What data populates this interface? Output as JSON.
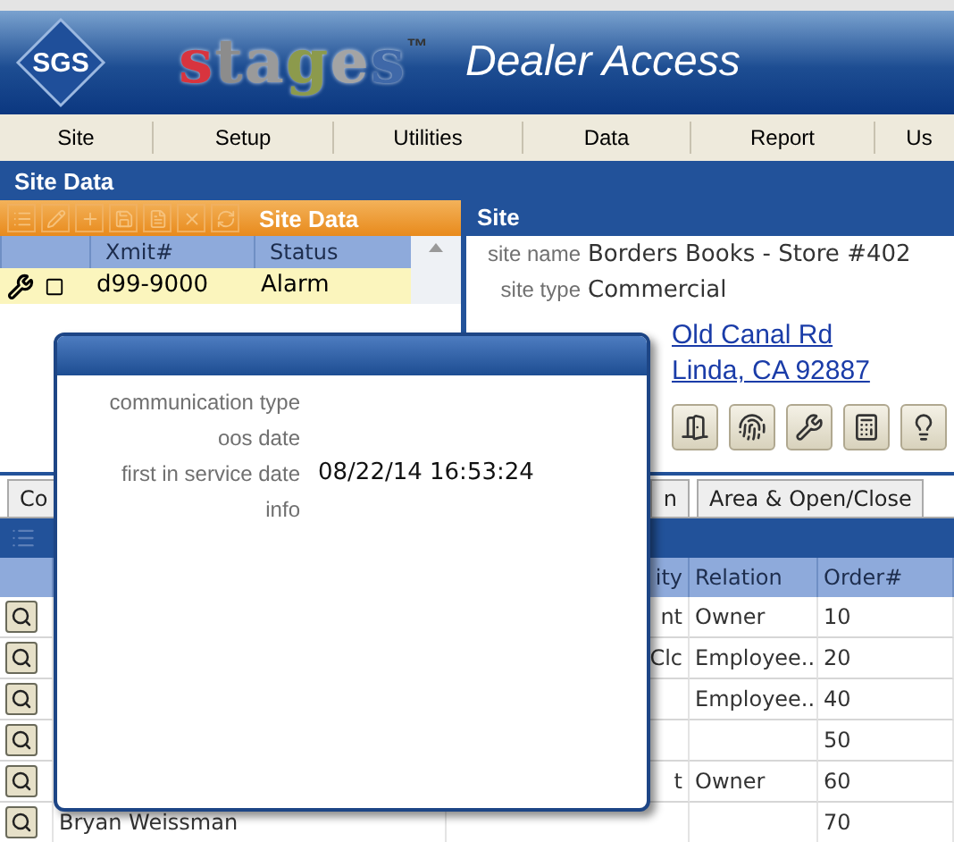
{
  "header": {
    "logo_mark": "SGS",
    "logo_letters": [
      {
        "char": "s",
        "color": "#d8343e"
      },
      {
        "char": "t",
        "color": "#8c8c8c"
      },
      {
        "char": "a",
        "color": "#9a9a9a"
      },
      {
        "char": "g",
        "color": "#8c9a4c"
      },
      {
        "char": "e",
        "color": "#a4a4a4"
      },
      {
        "char": "s",
        "color": "#3f68a8"
      }
    ],
    "trademark": "™",
    "title": "Dealer Access"
  },
  "menu": [
    {
      "label": "Site"
    },
    {
      "label": "Setup"
    },
    {
      "label": "Utilities"
    },
    {
      "label": "Data"
    },
    {
      "label": "Report"
    },
    {
      "label": "Us"
    }
  ],
  "section_title": "Site Data",
  "site_list": {
    "title": "Site Data",
    "columns": [
      "Xmit#",
      "Status"
    ],
    "rows": [
      {
        "xmit": "d99-9000",
        "status": "Alarm",
        "selected": true
      }
    ]
  },
  "site": {
    "title": "Site",
    "fields": [
      {
        "label": "site name",
        "value": "Borders Books - Store #402"
      },
      {
        "label": "site type",
        "value": "Commercial"
      }
    ],
    "address_lines": [
      "Old Canal Rd",
      "Linda, CA 92887"
    ]
  },
  "tabs": [
    {
      "label": "Co",
      "selected": false
    },
    {
      "label": "n",
      "selected": false
    },
    {
      "label": "Area & Open/Close",
      "selected": false
    }
  ],
  "contacts": {
    "columns": [
      "ity",
      "Relation",
      "Order#"
    ],
    "rows": [
      {
        "column_3": "nt",
        "relation": "Owner",
        "order": "10"
      },
      {
        "column_3": "Clc",
        "relation": "Employee..",
        "order": "20"
      },
      {
        "relation": "Employee..",
        "order": "40"
      },
      {
        "order": "50"
      },
      {
        "column_3": "t",
        "relation": "Owner",
        "order": "60"
      },
      {
        "name": "Bryan Weissman",
        "order": "70"
      }
    ]
  },
  "popup": {
    "fields": [
      {
        "label": "communication type"
      },
      {
        "label": "oos date"
      },
      {
        "label": "first in service date",
        "value": "08/22/14 16:53:24"
      },
      {
        "label": "info"
      }
    ]
  }
}
